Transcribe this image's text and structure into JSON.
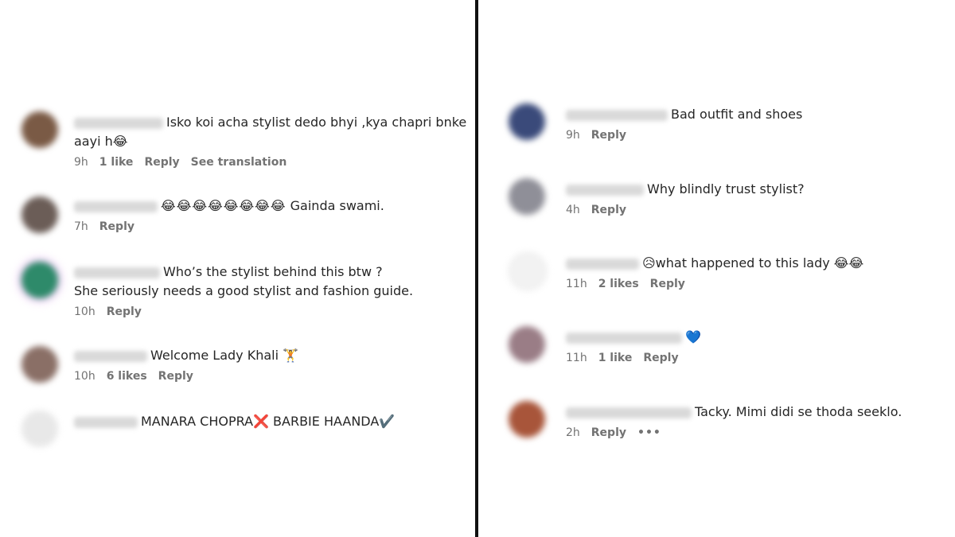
{
  "colors": {
    "divider": "#111111",
    "meta_text": "#737373",
    "comment_text": "#262626"
  },
  "left_comments": [
    {
      "avatar_color": "#7a5a45",
      "username_blurred": true,
      "text_line1": "Isko koi acha stylist dedo bhyi ,kya chapri bnke",
      "text_line2": "aayi h😂",
      "time": "9h",
      "likes": "1 like",
      "reply": "Reply",
      "extra": "See translation"
    },
    {
      "avatar_color": "#6b5d57",
      "username_blurred": true,
      "emojis": "😂😂😂😂😂😂😂😂",
      "text": "Gainda swami.",
      "time": "7h",
      "reply": "Reply"
    },
    {
      "avatar_color": "#2e8a6a",
      "username_blurred": true,
      "text_line1": "Who’s the stylist behind this btw ?",
      "text_line2": "She seriously needs a good stylist and fashion guide.",
      "time": "10h",
      "reply": "Reply"
    },
    {
      "avatar_color": "#8a6f66",
      "username_blurred": true,
      "text": "Welcome Lady Khali 🏋",
      "time": "10h",
      "likes": "6 likes",
      "reply": "Reply"
    },
    {
      "avatar_color": "#e8e8e8",
      "username_blurred": true,
      "text": "MANARA CHOPRA❌ BARBIE HAANDA✔️"
    }
  ],
  "right_comments": [
    {
      "avatar_color": "#3a4a7a",
      "username_blurred": true,
      "text": "Bad outfit and shoes",
      "time": "9h",
      "reply": "Reply"
    },
    {
      "avatar_color": "#8f8f98",
      "username_blurred": true,
      "text": "Why blindly trust stylist?",
      "time": "4h",
      "reply": "Reply"
    },
    {
      "avatar_color": "#eeeeee",
      "username_blurred": true,
      "text": "😥what happened to this lady 😂😂",
      "time": "11h",
      "likes": "2 likes",
      "reply": "Reply"
    },
    {
      "avatar_color": "#9a7d86",
      "username_blurred": true,
      "text": "💙",
      "time": "11h",
      "likes": "1 like",
      "reply": "Reply"
    },
    {
      "avatar_color": "#a8553a",
      "username_blurred": true,
      "text": "Tacky. Mimi didi se thoda seeklo.",
      "time": "2h",
      "reply": "Reply",
      "more": "•••"
    }
  ]
}
